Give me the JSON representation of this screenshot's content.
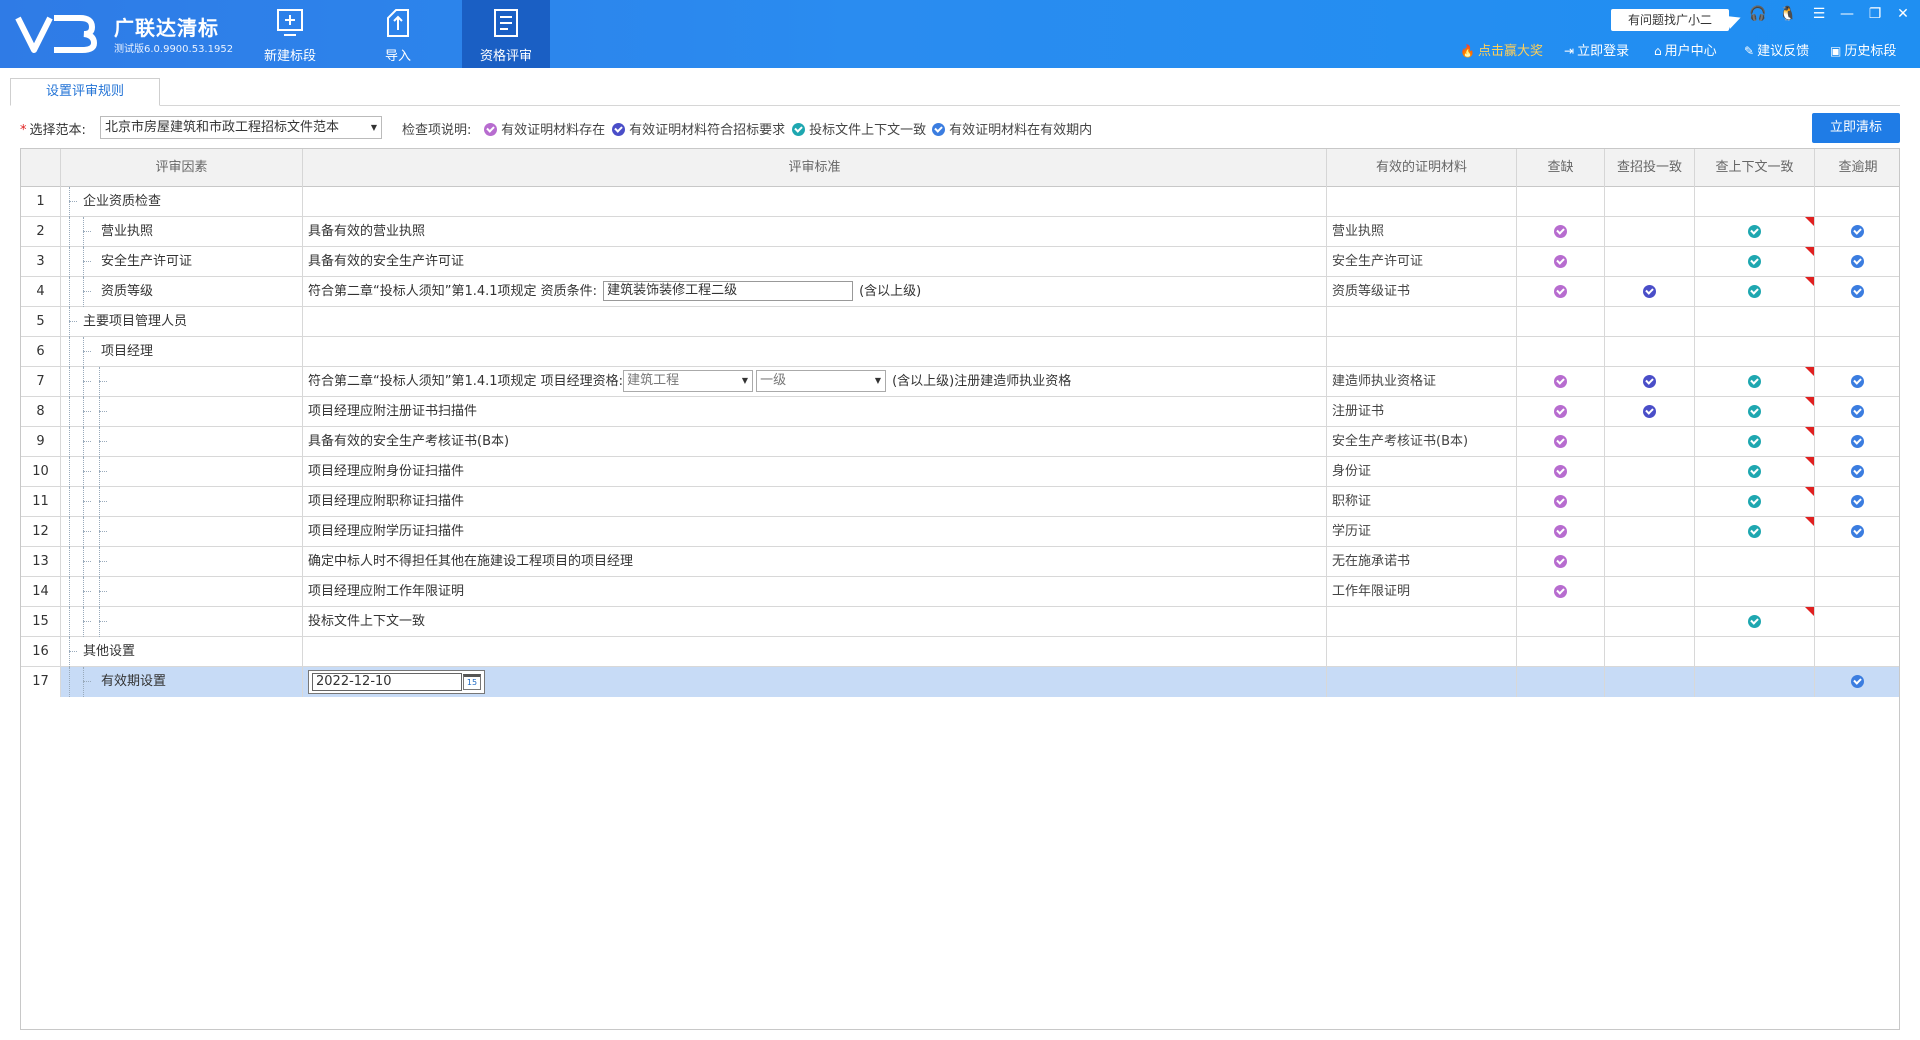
{
  "app": {
    "name": "广联达清标",
    "version": "测试版6.0.9900.53.1952"
  },
  "nav": [
    {
      "label": "新建标段",
      "icon": "new-section-icon"
    },
    {
      "label": "导入",
      "icon": "import-icon"
    },
    {
      "label": "资格评审",
      "icon": "qualification-review-icon",
      "active": true
    }
  ],
  "help": {
    "bubble": "有问题找广小二"
  },
  "links": {
    "prize": "点击赢大奖",
    "login": "立即登录",
    "user_center": "用户中心",
    "feedback": "建议反馈",
    "history": "历史标段"
  },
  "tabs": [
    {
      "label": "设置评审规则",
      "active": true
    }
  ],
  "filter": {
    "model_label": "选择范本:",
    "model_value": "北京市房屋建筑和市政工程招标文件范本",
    "check_label": "检查项说明:",
    "legend": [
      {
        "label": "有效证明材料存在",
        "color": "#b76ccf"
      },
      {
        "label": "有效证明材料符合招标要求",
        "color": "#4a4ec8"
      },
      {
        "label": "投标文件上下文一致",
        "color": "#1ea7b0"
      },
      {
        "label": "有效证明材料在有效期内",
        "color": "#3b7de0"
      }
    ],
    "clean_button": "立即清标"
  },
  "table": {
    "headers": [
      "评审因素",
      "评审标准",
      "有效的证明材料",
      "查缺",
      "查招投一致",
      "查上下文一致",
      "查逾期"
    ],
    "rows": [
      {
        "num": "1",
        "factor": "企业资质检查",
        "level": 0,
        "standard": "",
        "material": "",
        "c1": false,
        "c2": false,
        "c3": false,
        "c4": false,
        "flag": false
      },
      {
        "num": "2",
        "factor": "营业执照",
        "level": 1,
        "standard": "具备有效的营业执照",
        "material": "营业执照",
        "c1": true,
        "c2": false,
        "c3": true,
        "c4": true,
        "flag": true
      },
      {
        "num": "3",
        "factor": "安全生产许可证",
        "level": 1,
        "standard": "具备有效的安全生产许可证",
        "material": "安全生产许可证",
        "c1": true,
        "c2": false,
        "c3": true,
        "c4": true,
        "flag": true
      },
      {
        "num": "4",
        "factor": "资质等级",
        "level": 1,
        "standard_parts": {
          "pre": "符合第二章“投标人须知”第1.4.1项规定 资质条件:",
          "input": "建筑装饰装修工程二级",
          "post": "(含以上级)"
        },
        "material": "资质等级证书",
        "c1": true,
        "c2": true,
        "c3": true,
        "c4": true,
        "flag": true
      },
      {
        "num": "5",
        "factor": "主要项目管理人员",
        "level": 0,
        "standard": "",
        "material": "",
        "c1": false,
        "c2": false,
        "c3": false,
        "c4": false,
        "flag": false
      },
      {
        "num": "6",
        "factor": "项目经理",
        "level": 1,
        "standard": "",
        "material": "",
        "c1": false,
        "c2": false,
        "c3": false,
        "c4": false,
        "flag": false
      },
      {
        "num": "7",
        "factor": "",
        "level": 2,
        "standard_parts": {
          "pre": "符合第二章“投标人须知”第1.4.1项规定 项目经理资格:",
          "combo1": "建筑工程",
          "combo2": "一级",
          "post": "(含以上级)注册建造师执业资格"
        },
        "material": "建造师执业资格证",
        "c1": true,
        "c2": true,
        "c3": true,
        "c4": true,
        "flag": true
      },
      {
        "num": "8",
        "factor": "",
        "level": 2,
        "standard": "项目经理应附注册证书扫描件",
        "material": "注册证书",
        "c1": true,
        "c2": true,
        "c3": true,
        "c4": true,
        "flag": true
      },
      {
        "num": "9",
        "factor": "",
        "level": 2,
        "standard": "具备有效的安全生产考核证书(B本)",
        "material": "安全生产考核证书(B本)",
        "c1": true,
        "c2": false,
        "c3": true,
        "c4": true,
        "flag": true
      },
      {
        "num": "10",
        "factor": "",
        "level": 2,
        "standard": "项目经理应附身份证扫描件",
        "material": "身份证",
        "c1": true,
        "c2": false,
        "c3": true,
        "c4": true,
        "flag": true
      },
      {
        "num": "11",
        "factor": "",
        "level": 2,
        "standard": "项目经理应附职称证扫描件",
        "material": "职称证",
        "c1": true,
        "c2": false,
        "c3": true,
        "c4": true,
        "flag": true
      },
      {
        "num": "12",
        "factor": "",
        "level": 2,
        "standard": "项目经理应附学历证扫描件",
        "material": "学历证",
        "c1": true,
        "c2": false,
        "c3": true,
        "c4": true,
        "flag": true
      },
      {
        "num": "13",
        "factor": "",
        "level": 2,
        "standard": "确定中标人时不得担任其他在施建设工程项目的项目经理",
        "material": "无在施承诺书",
        "c1": true,
        "c2": false,
        "c3": false,
        "c4": false,
        "flag": false
      },
      {
        "num": "14",
        "factor": "",
        "level": 2,
        "standard": "项目经理应附工作年限证明",
        "material": "工作年限证明",
        "c1": true,
        "c2": false,
        "c3": false,
        "c4": false,
        "flag": false
      },
      {
        "num": "15",
        "factor": "",
        "level": 2,
        "standard": "投标文件上下文一致",
        "material": "",
        "c1": false,
        "c2": false,
        "c3": true,
        "c4": false,
        "flag": true
      },
      {
        "num": "16",
        "factor": "其他设置",
        "level": 0,
        "standard": "",
        "material": "",
        "c1": false,
        "c2": false,
        "c3": false,
        "c4": false,
        "flag": false
      },
      {
        "num": "17",
        "factor": "有效期设置",
        "level": 1,
        "date": "2022-12-10",
        "calendar_day": "15",
        "material": "",
        "c1": false,
        "c2": false,
        "c3": false,
        "c4": true,
        "flag": false,
        "selected": true
      }
    ]
  }
}
